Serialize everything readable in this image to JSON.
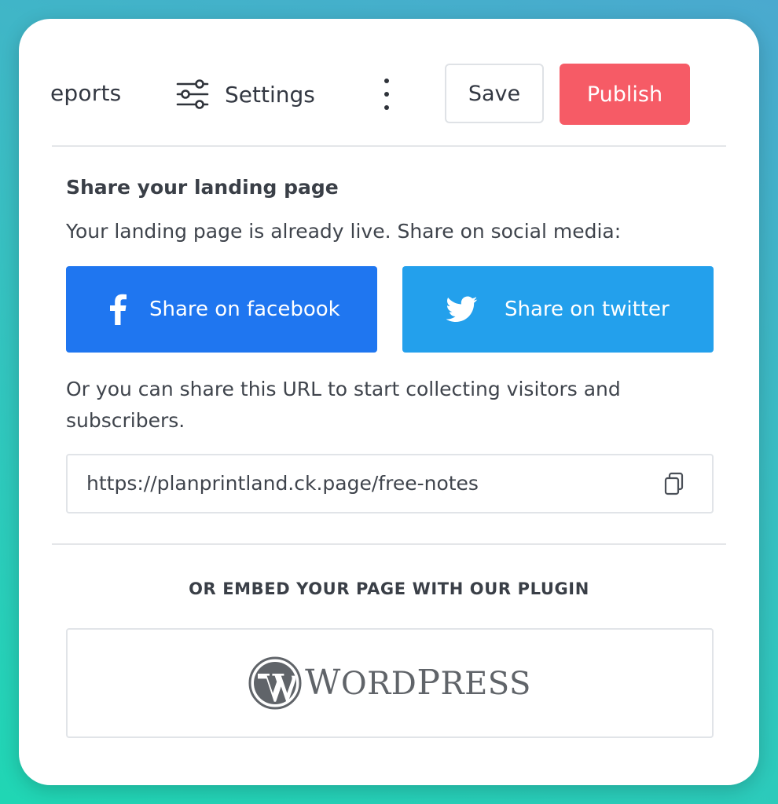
{
  "toolbar": {
    "reports_label": "eports",
    "settings_label": "Settings",
    "more_icon": "more-vertical-icon",
    "save_label": "Save",
    "publish_label": "Publish"
  },
  "share": {
    "heading": "Share your landing page",
    "subtext": "Your landing page is already live. Share on social media:",
    "facebook_label": "Share on facebook",
    "twitter_label": "Share on twitter",
    "or_text": "Or you can share this URL to start collecting visitors and subscribers.",
    "url": "https://planprintland.ck.page/free-notes",
    "copy_icon": "copy-icon"
  },
  "embed": {
    "title": "OR EMBED YOUR PAGE WITH OUR PLUGIN",
    "plugin_name": "WordPress"
  },
  "colors": {
    "publish": "#f65b66",
    "facebook": "#1f76f0",
    "twitter": "#23a0ec"
  }
}
